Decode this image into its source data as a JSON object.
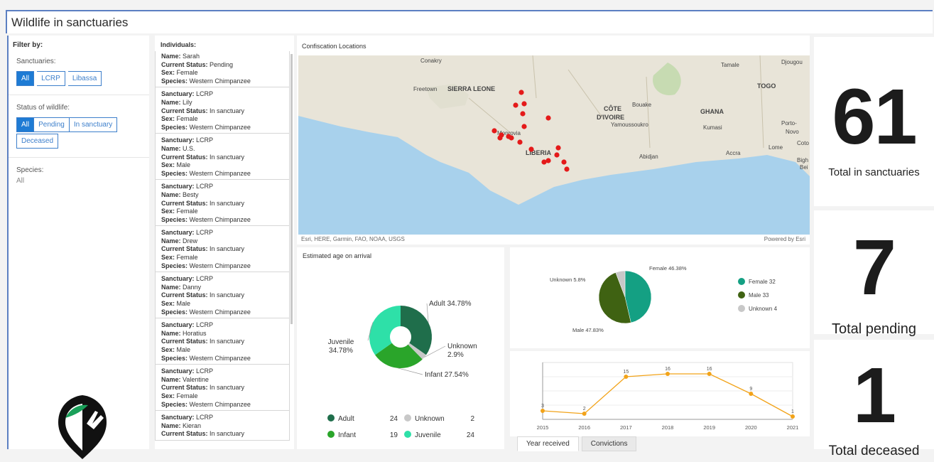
{
  "title": "Wildlife in sanctuaries",
  "filter": {
    "heading": "Filter by:",
    "sanctuaries_label": "Sanctuaries:",
    "sanctuaries": [
      "All",
      "LCRP",
      "Libassa"
    ],
    "status_label": "Status of wildlife:",
    "status": [
      "All",
      "Pending",
      "In sanctuary",
      "Deceased"
    ],
    "species_label": "Species:",
    "species_value": "All"
  },
  "individuals": {
    "heading": "Individuals:",
    "field_labels": {
      "sanctuary": "Sanctuary:",
      "name": "Name:",
      "status": "Current Status:",
      "sex": "Sex:",
      "species": "Species:"
    },
    "items": [
      {
        "sanctuary": null,
        "name": "Sarah",
        "status": "Pending",
        "sex": "Female",
        "species": "Western Chimpanzee"
      },
      {
        "sanctuary": "LCRP",
        "name": "Lily",
        "status": "In sanctuary",
        "sex": "Female",
        "species": "Western Chimpanzee"
      },
      {
        "sanctuary": "LCRP",
        "name": "U.S.",
        "status": "In sanctuary",
        "sex": "Male",
        "species": "Western Chimpanzee"
      },
      {
        "sanctuary": "LCRP",
        "name": "Besty",
        "status": "In sanctuary",
        "sex": "Female",
        "species": "Western Chimpanzee"
      },
      {
        "sanctuary": "LCRP",
        "name": "Drew",
        "status": "In sanctuary",
        "sex": "Female",
        "species": "Western Chimpanzee"
      },
      {
        "sanctuary": "LCRP",
        "name": "Danny",
        "status": "In sanctuary",
        "sex": "Male",
        "species": "Western Chimpanzee"
      },
      {
        "sanctuary": "LCRP",
        "name": "Horatius",
        "status": "In sanctuary",
        "sex": "Male",
        "species": "Western Chimpanzee"
      },
      {
        "sanctuary": "LCRP",
        "name": "Valentine",
        "status": "In sanctuary",
        "sex": "Female",
        "species": "Western Chimpanzee"
      },
      {
        "sanctuary": "LCRP",
        "name": "Kieran",
        "status": "In sanctuary",
        "sex": null,
        "species": null
      }
    ]
  },
  "map": {
    "heading": "Confiscation Locations",
    "attribution": "Esri, HERE, Garmin, FAO, NOAA, USGS",
    "powered": "Powered by Esri",
    "place_labels": [
      "Conakry",
      "Freetown",
      "SIERRA LEONE",
      "Monrovia",
      "LIBERIA",
      "CÔTE",
      "D'IVOIRE",
      "Bouake",
      "Yamoussoukro",
      "Abidjan",
      "GHANA",
      "Kumasi",
      "Accra",
      "Tamale",
      "TOGO",
      "Djougou",
      "Lome",
      "Porto-",
      "Novo",
      "Coto",
      "Bigh",
      "Bei"
    ]
  },
  "kpis": [
    {
      "value": "61",
      "caption": "Total in sanctuaries"
    },
    {
      "value": "7",
      "caption": "Total pending"
    },
    {
      "value": "1",
      "caption": "Total deceased"
    }
  ],
  "tabs": [
    "Year received",
    "Convictions"
  ],
  "colors": {
    "accent": "#1e7bd4",
    "adult": "#1f6e4b",
    "infant": "#2aa52a",
    "juvenile": "#2ee0a8",
    "unknown": "#c8c8c8",
    "female": "#14a083",
    "male": "#3f6212",
    "line": "#f2a319"
  },
  "chart_data": [
    {
      "type": "pie",
      "title": "Estimated age on arrival",
      "labels": [
        "Adult",
        "Unknown",
        "Infant",
        "Juvenile"
      ],
      "values": [
        24,
        2,
        19,
        24
      ],
      "percent_labels": [
        "Adult 34.78%",
        "Unknown 2.9%",
        "Infant 27.54%",
        "Juvenile 34.78%"
      ],
      "legend": [
        {
          "label": "Adult",
          "value": "24"
        },
        {
          "label": "Unknown",
          "value": "2"
        },
        {
          "label": "Infant",
          "value": "19"
        },
        {
          "label": "Juvenile",
          "value": "24"
        }
      ]
    },
    {
      "type": "pie",
      "labels": [
        "Female",
        "Male",
        "Unknown"
      ],
      "values": [
        32,
        33,
        4
      ],
      "percent_labels": [
        "Female 46.38%",
        "Male 47.83%",
        "Unknown 5.8%"
      ],
      "legend": [
        "Female 32",
        "Male 33",
        "Unknown 4"
      ]
    },
    {
      "type": "line",
      "x": [
        "2015",
        "2016",
        "2017",
        "2018",
        "2019",
        "2020",
        "2021"
      ],
      "values": [
        3,
        2,
        15,
        16,
        16,
        9,
        1
      ],
      "ylim": [
        0,
        20
      ],
      "grid": true
    }
  ]
}
